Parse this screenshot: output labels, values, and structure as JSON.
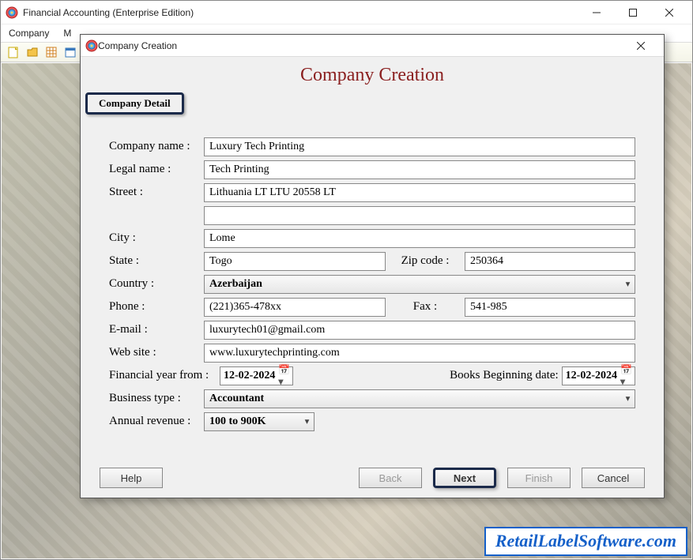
{
  "main_window": {
    "title": "Financial Accounting (Enterprise Edition)",
    "menubar": {
      "company": "Company",
      "m_item": "M"
    }
  },
  "dialog": {
    "title": "Company Creation",
    "heading": "Company Creation",
    "section_label": "Company Detail",
    "labels": {
      "company_name": "Company name :",
      "legal_name": "Legal name :",
      "street": "Street :",
      "city": "City :",
      "state": "State :",
      "zip": "Zip code :",
      "country": "Country :",
      "phone": "Phone :",
      "fax": "Fax :",
      "email": "E-mail :",
      "website": "Web site :",
      "fin_year": "Financial year from :",
      "books_begin": "Books Beginning date:",
      "business_type": "Business type :",
      "annual_revenue": "Annual revenue :"
    },
    "values": {
      "company_name": "Luxury Tech Printing",
      "legal_name": "Tech Printing",
      "street": "Lithuania LT LTU 20558 LT",
      "street2": "",
      "city": "Lome",
      "state": "Togo",
      "zip": "250364",
      "country": "Azerbaijan",
      "phone": "(221)365-478xx",
      "fax": "541-985",
      "email": "luxurytech01@gmail.com",
      "website": "www.luxurytechprinting.com",
      "fin_year": "12-02-2024",
      "books_begin": "12-02-2024",
      "business_type": "Accountant",
      "annual_revenue": "100 to 900K"
    },
    "buttons": {
      "help": "Help",
      "back": "Back",
      "next": "Next",
      "finish": "Finish",
      "cancel": "Cancel"
    }
  },
  "watermark": "RetailLabelSoftware.com"
}
